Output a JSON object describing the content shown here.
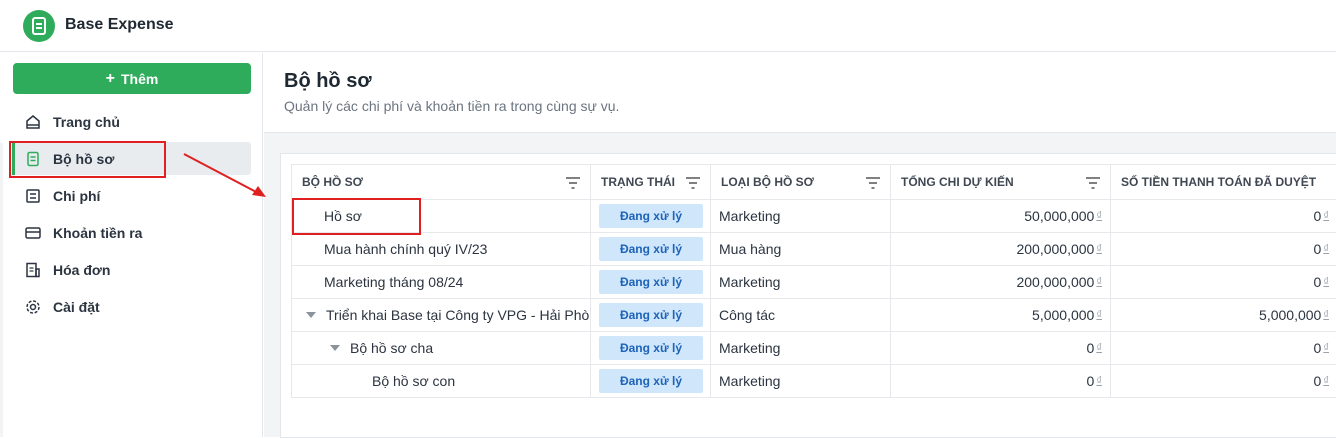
{
  "app": {
    "title": "Base Expense",
    "brand_color": "#2eac5c"
  },
  "sidebar": {
    "add_button": "Thêm",
    "items": [
      {
        "label": "Trang chủ",
        "icon": "home-icon"
      },
      {
        "label": "Bộ hồ sơ",
        "icon": "document-icon",
        "active": true
      },
      {
        "label": "Chi phí",
        "icon": "list-icon"
      },
      {
        "label": "Khoản tiền ra",
        "icon": "card-icon"
      },
      {
        "label": "Hóa đơn",
        "icon": "invoice-icon"
      },
      {
        "label": "Cài đặt",
        "icon": "gear-icon"
      }
    ]
  },
  "page": {
    "title": "Bộ hồ sơ",
    "subtitle": "Quản lý các chi phí và khoản tiền ra trong cùng sự vụ."
  },
  "table": {
    "columns": [
      "BỘ HỒ SƠ",
      "TRẠNG THÁI",
      "LOẠI BỘ HỒ SƠ",
      "TỔNG CHI DỰ KIẾN",
      "SỐ TIỀN THANH TOÁN ĐÃ DUYỆT"
    ],
    "currency_symbol": "₫",
    "rows": [
      {
        "name": "Hồ sơ",
        "status": "Đang xử lý",
        "type": "Marketing",
        "total": "50,000,000",
        "paid": "0"
      },
      {
        "name": "Mua hành chính quý IV/23",
        "status": "Đang xử lý",
        "type": "Mua hàng",
        "total": "200,000,000",
        "paid": "0"
      },
      {
        "name": "Marketing tháng 08/24",
        "status": "Đang xử lý",
        "type": "Marketing",
        "total": "200,000,000",
        "paid": "0"
      },
      {
        "name": "Triển khai Base tại Công ty VPG - Hải Phòng",
        "status": "Đang xử lý",
        "type": "Công tác",
        "total": "5,000,000",
        "paid": "5,000,000"
      },
      {
        "name": "Bộ hồ sơ cha",
        "status": "Đang xử lý",
        "type": "Marketing",
        "total": "0",
        "paid": "0"
      },
      {
        "name": "Bộ hồ sơ con",
        "status": "Đang xử lý",
        "type": "Marketing",
        "total": "0",
        "paid": "0"
      }
    ]
  },
  "annotation_color": "#e02020"
}
